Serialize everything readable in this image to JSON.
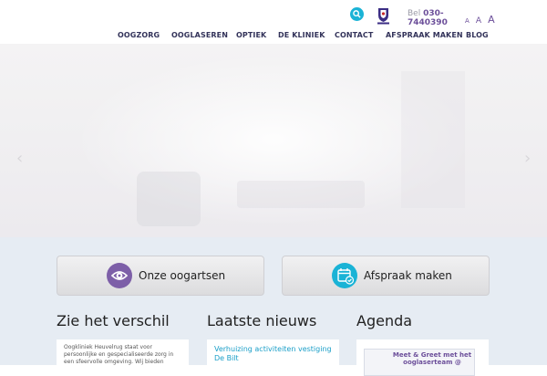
{
  "header": {
    "phone_label": "Bel",
    "phone_number_part1": "030-",
    "phone_number_part2": "7440390",
    "font_sizes": [
      "A",
      "A",
      "A"
    ],
    "search_icon": "search-icon",
    "crest_icon": "crest-icon"
  },
  "nav": {
    "items": [
      {
        "label": "OOGZORG"
      },
      {
        "label": "OOGLASEREN"
      },
      {
        "label": "OPTIEK"
      },
      {
        "label": "DE KLINIEK"
      },
      {
        "label": "CONTACT"
      },
      {
        "label": "AFSPRAAK MAKEN"
      },
      {
        "label": "BLOG"
      }
    ]
  },
  "hero": {
    "prev_arrow": "‹",
    "next_arrow": "›"
  },
  "cta": {
    "doctors_label": "Onze oogartsen",
    "appointment_label": "Afspraak maken"
  },
  "columns": {
    "difference_title": "Zie het verschil",
    "difference_text": "Oogkliniek Heuvelrug staat voor persoonlijke en gespecialiseerde zorg in een sfeervolle omgeving. Wij bieden",
    "news_title": "Laatste nieuws",
    "news_item": "Verhuizing activiteiten vestiging De Bilt",
    "agenda_title": "Agenda",
    "agenda_item": "Meet & Greet met het ooglaserteam @"
  },
  "colors": {
    "brand_purple": "#6c4f9a",
    "brand_cyan": "#1ab3d6",
    "nav_text": "#33335a"
  }
}
